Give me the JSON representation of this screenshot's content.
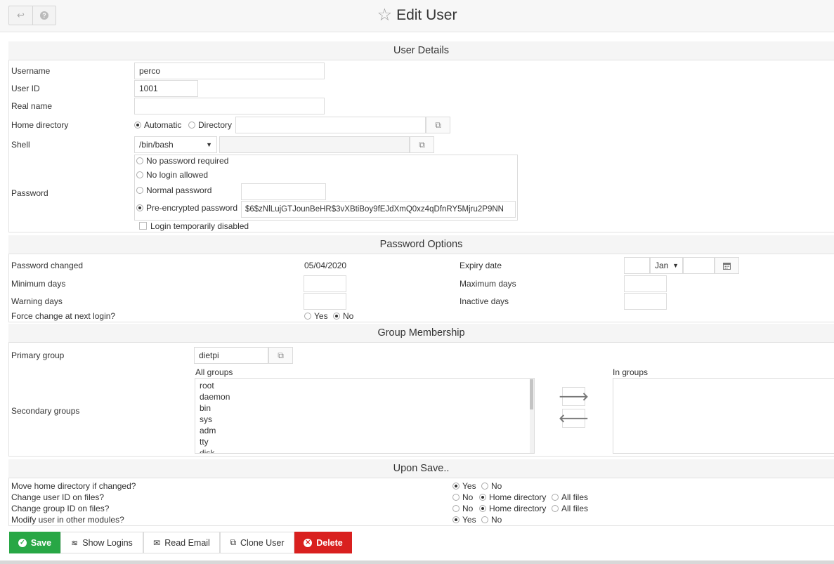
{
  "toolbar": {
    "back_icon": "return-arrow-icon",
    "help_icon": "help-icon",
    "help_glyph": "?"
  },
  "page": {
    "title": "Edit User",
    "star_icon": "star-outline-icon"
  },
  "user_details": {
    "heading": "User Details",
    "username_label": "Username",
    "username_value": "perco",
    "uid_label": "User ID",
    "uid_value": "1001",
    "realname_label": "Real name",
    "realname_value": "",
    "home_label": "Home directory",
    "home_automatic": "Automatic",
    "home_directory": "Directory",
    "home_value": "",
    "shell_label": "Shell",
    "shell_value": "/bin/bash",
    "shell_other_value": "",
    "password_label": "Password",
    "pw_none": "No password required",
    "pw_nologin": "No login allowed",
    "pw_normal": "Normal password",
    "pw_normal_value": "",
    "pw_preenc": "Pre-encrypted password",
    "pw_preenc_value": "$6$zNlLujGTJounBeHR$3vXBtiBoy9fEJdXmQ0xz4qDfnRY5Mjru2P9NN",
    "login_disabled": "Login temporarily disabled"
  },
  "password_options": {
    "heading": "Password Options",
    "changed_label": "Password changed",
    "changed_value": "05/04/2020",
    "expiry_label": "Expiry date",
    "expiry_month": "Jan",
    "expiry_day": "",
    "expiry_year": "",
    "min_label": "Minimum days",
    "max_label": "Maximum days",
    "warn_label": "Warning days",
    "inactive_label": "Inactive days",
    "force_label": "Force change at next login?",
    "yes": "Yes",
    "no": "No"
  },
  "group_membership": {
    "heading": "Group Membership",
    "primary_label": "Primary group",
    "primary_value": "dietpi",
    "secondary_label": "Secondary groups",
    "all_groups_label": "All groups",
    "in_groups_label": "In groups",
    "all_groups": [
      "root",
      "daemon",
      "bin",
      "sys",
      "adm",
      "tty",
      "disk"
    ],
    "in_groups": []
  },
  "upon_save": {
    "heading": "Upon Save..",
    "move_home": "Move home directory if changed?",
    "change_uid": "Change user ID on files?",
    "change_gid": "Change group ID on files?",
    "modify_other": "Modify user in other modules?",
    "yes": "Yes",
    "no": "No",
    "home_directory": "Home directory",
    "all_files": "All files"
  },
  "actions": {
    "save": "Save",
    "show_logins": "Show Logins",
    "read_email": "Read Email",
    "clone_user": "Clone User",
    "delete": "Delete"
  },
  "colors": {
    "save_bg": "#28a745",
    "delete_bg": "#d9201f"
  }
}
